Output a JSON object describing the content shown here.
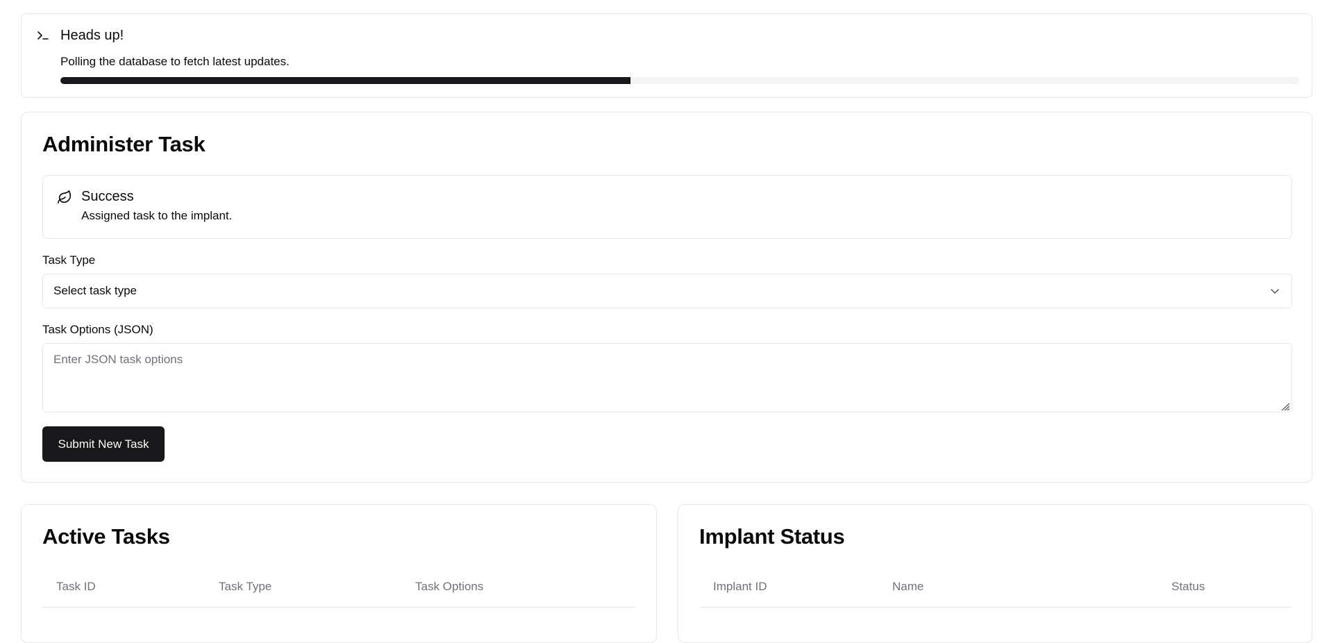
{
  "heads_up": {
    "title": "Heads up!",
    "description": "Polling the database to fetch latest updates.",
    "icon": "terminal-icon",
    "progress_fraction": 0.46
  },
  "administer": {
    "title": "Administer Task",
    "success": {
      "icon": "leaf-icon",
      "title": "Success",
      "description": "Assigned task to the implant."
    },
    "task_type": {
      "label": "Task Type",
      "value": "Select task type"
    },
    "task_options": {
      "label": "Task Options (JSON)",
      "placeholder": "Enter JSON task options"
    },
    "submit_label": "Submit New Task"
  },
  "active_tasks": {
    "title": "Active Tasks",
    "columns": [
      "Task ID",
      "Task Type",
      "Task Options"
    ]
  },
  "implant_status": {
    "title": "Implant Status",
    "columns": [
      "Implant ID",
      "Name",
      "Status"
    ]
  },
  "colors": {
    "primary": "#18181b",
    "border": "#e5e7eb",
    "muted_text": "#71717a",
    "progress_track": "#f4f4f5"
  }
}
